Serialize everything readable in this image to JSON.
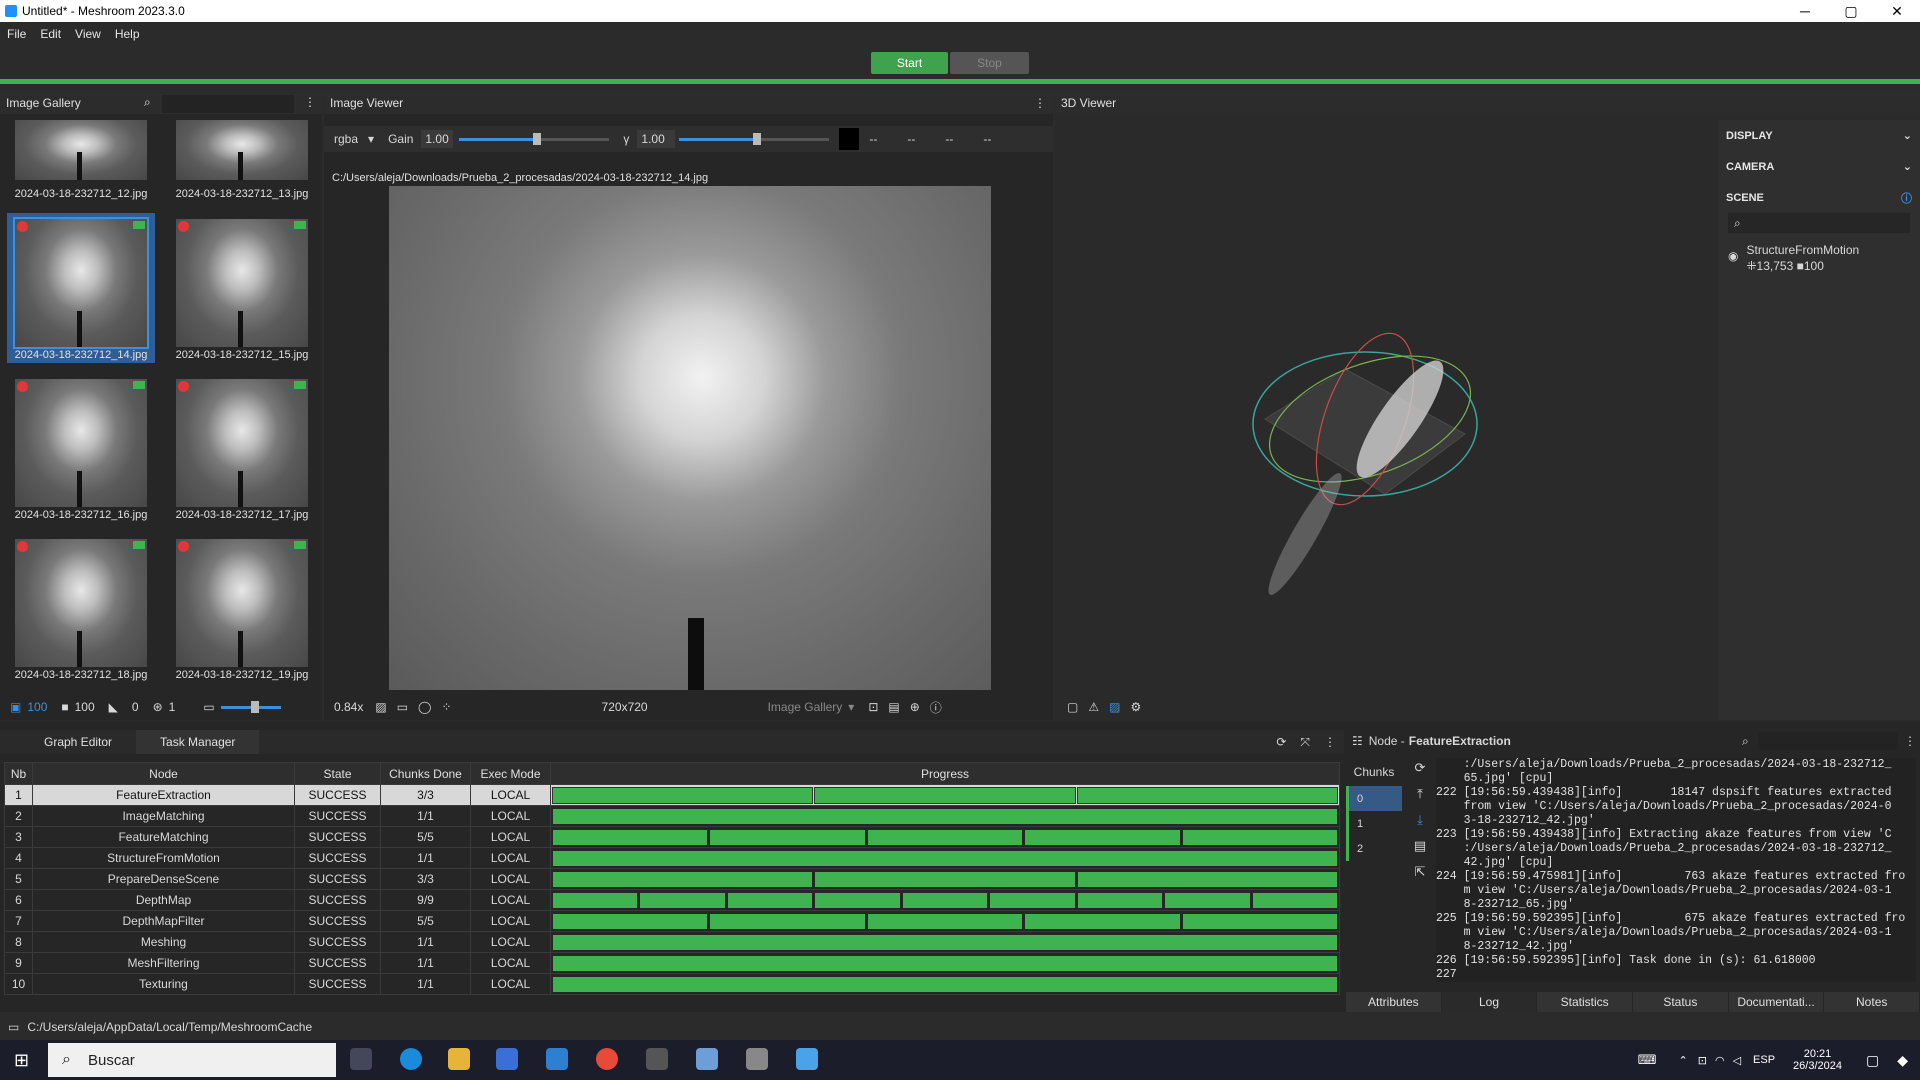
{
  "window": {
    "title": "Untitled* - Meshroom 2023.3.0",
    "minimize": "─",
    "maximize": "▢",
    "close": "✕"
  },
  "menu": {
    "file": "File",
    "edit": "Edit",
    "view": "View",
    "help": "Help"
  },
  "run": {
    "start": "Start",
    "stop": "Stop"
  },
  "gallery": {
    "title": "Image Gallery",
    "thumbs": [
      "2024-03-18-232712_12.jpg",
      "2024-03-18-232712_13.jpg",
      "2024-03-18-232712_14.jpg",
      "2024-03-18-232712_15.jpg",
      "2024-03-18-232712_16.jpg",
      "2024-03-18-232712_17.jpg",
      "2024-03-18-232712_18.jpg",
      "2024-03-18-232712_19.jpg"
    ],
    "footer": {
      "images": "100",
      "cameras": "100",
      "no_intrinsic": "0",
      "rigs": "1"
    }
  },
  "image_viewer": {
    "title": "Image Viewer",
    "channel": "rgba",
    "gain_label": "Gain",
    "gain_value": "1.00",
    "gamma_label": "γ",
    "gamma_value": "1.00",
    "readouts": [
      "--",
      "--",
      "--",
      "--"
    ],
    "path": "C:/Users/aleja/Downloads/Prueba_2_procesadas/2024-03-18-232712_14.jpg",
    "zoom": "0.84x",
    "resolution": "720x720",
    "source": "Image Gallery"
  },
  "viewer3d": {
    "title": "3D Viewer",
    "display": "DISPLAY",
    "camera": "CAMERA",
    "scene": "SCENE",
    "node_name": "StructureFromMotion",
    "points": "13,753",
    "cameras": "100"
  },
  "tabs": {
    "graph_editor": "Graph Editor",
    "task_manager": "Task Manager"
  },
  "task_table": {
    "headers": [
      "Nb",
      "Node",
      "State",
      "Chunks Done",
      "Exec Mode",
      "Progress"
    ],
    "rows": [
      {
        "nb": "1",
        "node": "FeatureExtraction",
        "state": "SUCCESS",
        "chunks": "3/3",
        "mode": "LOCAL",
        "n": 3
      },
      {
        "nb": "2",
        "node": "ImageMatching",
        "state": "SUCCESS",
        "chunks": "1/1",
        "mode": "LOCAL",
        "n": 1
      },
      {
        "nb": "3",
        "node": "FeatureMatching",
        "state": "SUCCESS",
        "chunks": "5/5",
        "mode": "LOCAL",
        "n": 5
      },
      {
        "nb": "4",
        "node": "StructureFromMotion",
        "state": "SUCCESS",
        "chunks": "1/1",
        "mode": "LOCAL",
        "n": 1
      },
      {
        "nb": "5",
        "node": "PrepareDenseScene",
        "state": "SUCCESS",
        "chunks": "3/3",
        "mode": "LOCAL",
        "n": 3
      },
      {
        "nb": "6",
        "node": "DepthMap",
        "state": "SUCCESS",
        "chunks": "9/9",
        "mode": "LOCAL",
        "n": 9
      },
      {
        "nb": "7",
        "node": "DepthMapFilter",
        "state": "SUCCESS",
        "chunks": "5/5",
        "mode": "LOCAL",
        "n": 5
      },
      {
        "nb": "8",
        "node": "Meshing",
        "state": "SUCCESS",
        "chunks": "1/1",
        "mode": "LOCAL",
        "n": 1
      },
      {
        "nb": "9",
        "node": "MeshFiltering",
        "state": "SUCCESS",
        "chunks": "1/1",
        "mode": "LOCAL",
        "n": 1
      },
      {
        "nb": "10",
        "node": "Texturing",
        "state": "SUCCESS",
        "chunks": "1/1",
        "mode": "LOCAL",
        "n": 1
      }
    ]
  },
  "node_panel": {
    "prefix": "Node - ",
    "name": "FeatureExtraction",
    "chunks_label": "Chunks",
    "chunks": [
      "0",
      "1",
      "2"
    ],
    "log": [
      "    :/Users/aleja/Downloads/Prueba_2_procesadas/2024-03-18-232712_",
      "    65.jpg' [cpu]",
      "222 [19:56:59.439438][info]       18147 dspsift features extracted",
      "    from view 'C:/Users/aleja/Downloads/Prueba_2_procesadas/2024-0",
      "    3-18-232712_42.jpg'",
      "223 [19:56:59.439438][info] Extracting akaze features from view 'C",
      "    :/Users/aleja/Downloads/Prueba_2_procesadas/2024-03-18-232712_",
      "    42.jpg' [cpu]",
      "224 [19:56:59.475981][info]         763 akaze features extracted fro",
      "    m view 'C:/Users/aleja/Downloads/Prueba_2_procesadas/2024-03-1",
      "    8-232712_65.jpg'",
      "225 [19:56:59.592395][info]         675 akaze features extracted fro",
      "    m view 'C:/Users/aleja/Downloads/Prueba_2_procesadas/2024-03-1",
      "    8-232712_42.jpg'",
      "226 [19:56:59.592395][info] Task done in (s): 61.618000",
      "227"
    ],
    "tabs": [
      "Attributes",
      "Log",
      "Statistics",
      "Status",
      "Documentati...",
      "Notes"
    ]
  },
  "statusbar": {
    "path": "C:/Users/aleja/AppData/Local/Temp/MeshroomCache"
  },
  "taskbar": {
    "search": "Buscar",
    "lang": "ESP",
    "time": "20:21",
    "date": "26/3/2024"
  },
  "colors": {
    "accent_green": "#3fb34f",
    "selection_blue": "#2f5d95"
  }
}
